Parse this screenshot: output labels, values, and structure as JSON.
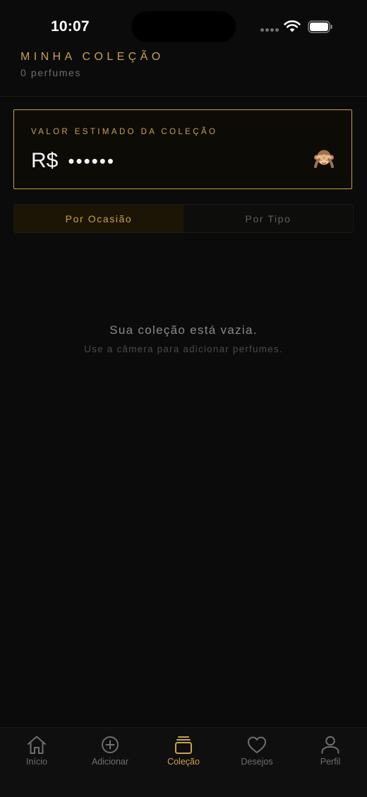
{
  "status_bar": {
    "time": "10:07"
  },
  "header": {
    "title": "MINHA COLEÇÃO",
    "count_label": "0 perfumes"
  },
  "value_card": {
    "label": "VALOR ESTIMADO DA COLEÇÃO",
    "currency": "R$",
    "masked_value": "••••••",
    "toggle_icon": "see-no-evil-monkey-icon"
  },
  "segments": [
    {
      "label": "Por Ocasião",
      "active": true
    },
    {
      "label": "Por Tipo",
      "active": false
    }
  ],
  "empty_state": {
    "title": "Sua coleção está vazia.",
    "subtitle": "Use a câmera para adicionar perfumes."
  },
  "tab_bar": {
    "items": [
      {
        "label": "Início",
        "icon": "home-icon",
        "active": false
      },
      {
        "label": "Adicionar",
        "icon": "plus-circle-icon",
        "active": false
      },
      {
        "label": "Coleção",
        "icon": "collection-stack-icon",
        "active": true
      },
      {
        "label": "Desejos",
        "icon": "heart-icon",
        "active": false
      },
      {
        "label": "Perfil",
        "icon": "person-icon",
        "active": false
      }
    ]
  },
  "colors": {
    "background": "#0b0b0b",
    "accent_gold": "#c9a24c",
    "inactive_text": "#6f6f6f"
  }
}
